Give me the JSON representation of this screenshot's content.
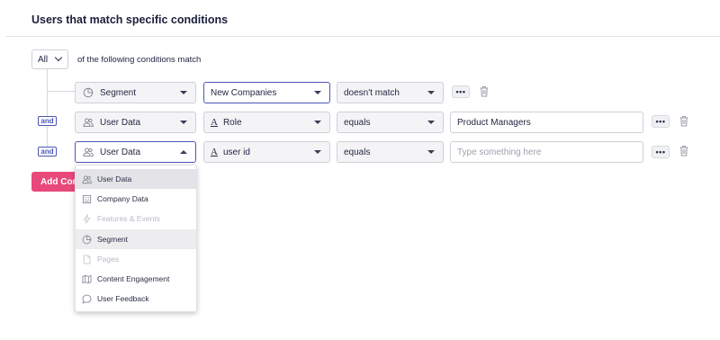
{
  "title": "Users that match specific conditions",
  "match": {
    "selector_value": "All",
    "text": "of the following conditions match"
  },
  "connector": "and",
  "rows": [
    {
      "source": "Segment",
      "source_icon": "pie-chart-icon",
      "attribute": "New Companies",
      "operator": "doesn't match",
      "value": ""
    },
    {
      "source": "User Data",
      "source_icon": "users-icon",
      "attribute": "Role",
      "operator": "equals",
      "value": "Product Managers"
    },
    {
      "source": "User Data",
      "source_icon": "users-icon",
      "attribute": "user id",
      "operator": "equals",
      "value": "",
      "value_placeholder": "Type something here"
    }
  ],
  "more_label": "•••",
  "add_button": "Add Condition",
  "menu": {
    "items": [
      {
        "label": "User Data",
        "icon": "users-icon",
        "state": "selected"
      },
      {
        "label": "Company Data",
        "icon": "building-icon",
        "state": "normal"
      },
      {
        "label": "Features & Events",
        "icon": "lightning-icon",
        "state": "disabled"
      },
      {
        "label": "Segment",
        "icon": "pie-chart-icon",
        "state": "hover"
      },
      {
        "label": "Pages",
        "icon": "document-icon",
        "state": "disabled"
      },
      {
        "label": "Content Engagement",
        "icon": "map-icon",
        "state": "normal"
      },
      {
        "label": "User Feedback",
        "icon": "chat-bubble-icon",
        "state": "normal"
      }
    ]
  },
  "colors": {
    "accent": "#4b56b8",
    "primary_button": "#e8497a",
    "selected_row": "#e4e4e8"
  }
}
